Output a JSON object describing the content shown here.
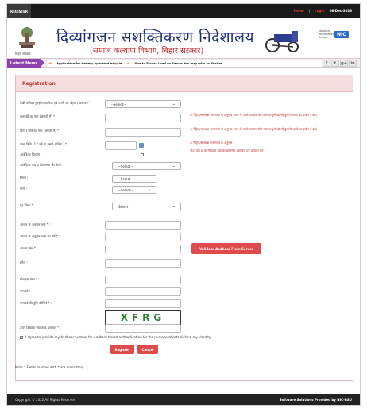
{
  "topbar": {
    "register_tab": "REGISTER",
    "home": "Home",
    "separator": "|",
    "login": "Login",
    "date": "06-Dec-2023"
  },
  "header": {
    "emblem_caption": "बिहार सरकार",
    "title": "दिव्यांगजन सशक्तिकरण निदेशालय",
    "subtitle": "(समाज कल्याण विभाग, बिहार सरकार)",
    "partner_small": "National Informatics Centre",
    "partner_logo": "NIC"
  },
  "news": {
    "label": "Latest News",
    "items": [
      "Application for battery operated tricycle",
      "Due to Excess Load on Server You may miss to finalize"
    ],
    "social": [
      "f",
      "t",
      "g+",
      "in"
    ]
  },
  "form": {
    "title": "Registration",
    "fields": [
      {
        "label": "देखी यशिका गुरुई सहयाविक एवं कामी का उद्देश्य / प्रयोजन*",
        "type": "select",
        "value": "--Select--"
      },
      {
        "label": "लाभार्थी का नाम (अंग्रेजी में) *",
        "type": "input"
      },
      {
        "label": "पिता / पति का नाम (अंग्रेजी में) *",
        "type": "input"
      },
      {
        "label": "जन्म तिथि (12 वर्ष या उससे अधिक ) * :",
        "type": "date"
      },
      {
        "label": "आवेदिका दिव्यांग :",
        "type": "checkbox"
      },
      {
        "label": "आवेदिका कद व दिव्यांगता की श्रेणी :",
        "type": "select",
        "value": "--Select--"
      },
      {
        "label": "जिला :",
        "type": "select",
        "value": "--Select--"
      },
      {
        "label": "श्रेणी :",
        "type": "select",
        "value": "--Select--"
      },
      {
        "label": "गृह जिला *",
        "type": "select",
        "value": "Select"
      },
      {
        "label": "आधार के अनुसार नाम * :",
        "type": "input"
      },
      {
        "label": "आधार के अनुसार जन्म का वर्ष * :",
        "type": "input"
      },
      {
        "label": "आधार नंबर * :",
        "type": "input"
      },
      {
        "label": "ईमेल :",
        "type": "input"
      },
      {
        "label": "मोबाइल नंबर * :",
        "type": "input"
      },
      {
        "label": "पासवर्ड :",
        "type": "input"
      },
      {
        "label": "पासवर्ड की पुष्टि कीजिये * :",
        "type": "input"
      },
      {
        "label": "ऊपर दिखाया गया कोड दर्ज करें * :",
        "type": "input"
      }
    ],
    "hints": [
      "# मैट्रिक/समकक्ष प्रमाणपत्र के अनुसार (नाम के पहले उपनाम जैसे श्रीमान/सुश्री/डॉ/श्री/कुमारी आदि का प्रयोग न करें)",
      "# मैट्रिक/समकक्ष प्रमाणपत्र के अनुसार (नाम के पहले उपनाम जैसे श्रीमान/सुश्री/डॉ/श्री/कुमारी आदि का प्रयोग न करें)",
      "# मैट्रिक/समकक्ष प्रमाणपत्र के अनुसार",
      "नोट: यदि हाँ तो मेडिकल बोर्ड का प्रमाणित दस्तावेज एवं आवेदन करें"
    ],
    "validate_button": "Validate Aadhaar From Server",
    "captcha": "XFRG",
    "consent": "I agree to provide my Aadhaar number for Aadhaar based authentication for the purpose of establishing my identity",
    "register_button": "Register",
    "cancel_button": "Cancel",
    "note": "Note :- Fields marked with * are mandatory"
  },
  "footer": {
    "copyright": "Copyright © 2022 All Rights Reserved",
    "provider": "Software Solutions Provided by NIC-BSU"
  }
}
